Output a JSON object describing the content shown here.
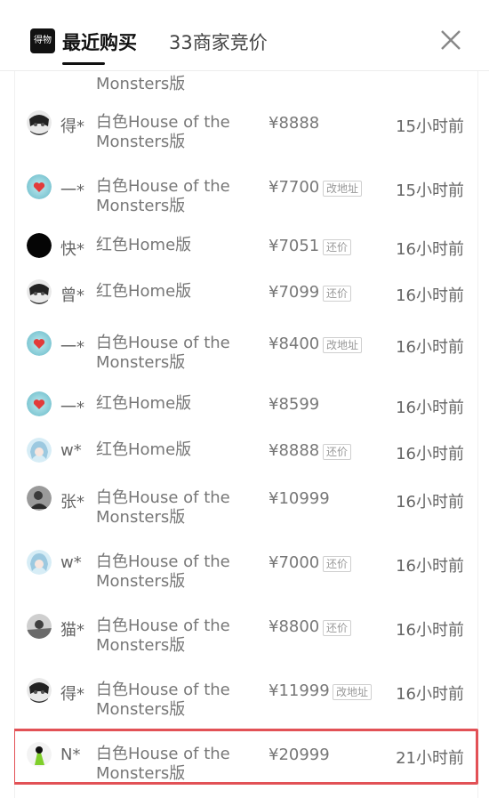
{
  "header": {
    "logo_text": "得物",
    "tab_active": "最近购买",
    "tab_other": "33商家竞价"
  },
  "list_partial_top": "Monsters版",
  "colors": {
    "highlight": "#e25156",
    "tag_border": "#cfcfcf"
  },
  "rows": [
    {
      "buyer": "得*",
      "variant": "白色House of the Monsters版",
      "price": "¥8888",
      "tag": "",
      "time": "15小时前",
      "avatar": "anime-dark-avatar"
    },
    {
      "buyer": "一*",
      "variant": "白色House of the Monsters版",
      "price": "¥7700",
      "tag": "改地址",
      "time": "15小时前",
      "avatar": "heart-avatar"
    },
    {
      "buyer": "快*",
      "variant": "红色Home版",
      "price": "¥7051",
      "tag": "还价",
      "time": "16小时前",
      "avatar": "black-avatar"
    },
    {
      "buyer": "曾*",
      "variant": "红色Home版",
      "price": "¥7099",
      "tag": "还价",
      "time": "16小时前",
      "avatar": "anime-dark-avatar"
    },
    {
      "buyer": "一*",
      "variant": "白色House of the Monsters版",
      "price": "¥8400",
      "tag": "改地址",
      "time": "16小时前",
      "avatar": "heart-avatar"
    },
    {
      "buyer": "一*",
      "variant": "红色Home版",
      "price": "¥8599",
      "tag": "",
      "time": "16小时前",
      "avatar": "heart-avatar"
    },
    {
      "buyer": "w*",
      "variant": "红色Home版",
      "price": "¥8888",
      "tag": "还价",
      "time": "16小时前",
      "avatar": "blue-hair-avatar"
    },
    {
      "buyer": "张*",
      "variant": "白色House of the Monsters版",
      "price": "¥10999",
      "tag": "",
      "time": "16小时前",
      "avatar": "photo-avatar"
    },
    {
      "buyer": "w*",
      "variant": "白色House of the Monsters版",
      "price": "¥7000",
      "tag": "还价",
      "time": "16小时前",
      "avatar": "blue-hair-avatar"
    },
    {
      "buyer": "猫*",
      "variant": "白色House of the Monsters版",
      "price": "¥8800",
      "tag": "还价",
      "time": "16小时前",
      "avatar": "cat-photo-avatar"
    },
    {
      "buyer": "得*",
      "variant": "白色House of the Monsters版",
      "price": "¥11999",
      "tag": "改地址",
      "time": "16小时前",
      "avatar": "anime-dark-avatar"
    },
    {
      "buyer": "N*",
      "variant": "白色House of the Monsters版",
      "price": "¥20999",
      "tag": "",
      "time": "21小时前",
      "avatar": "green-figure-avatar"
    }
  ]
}
